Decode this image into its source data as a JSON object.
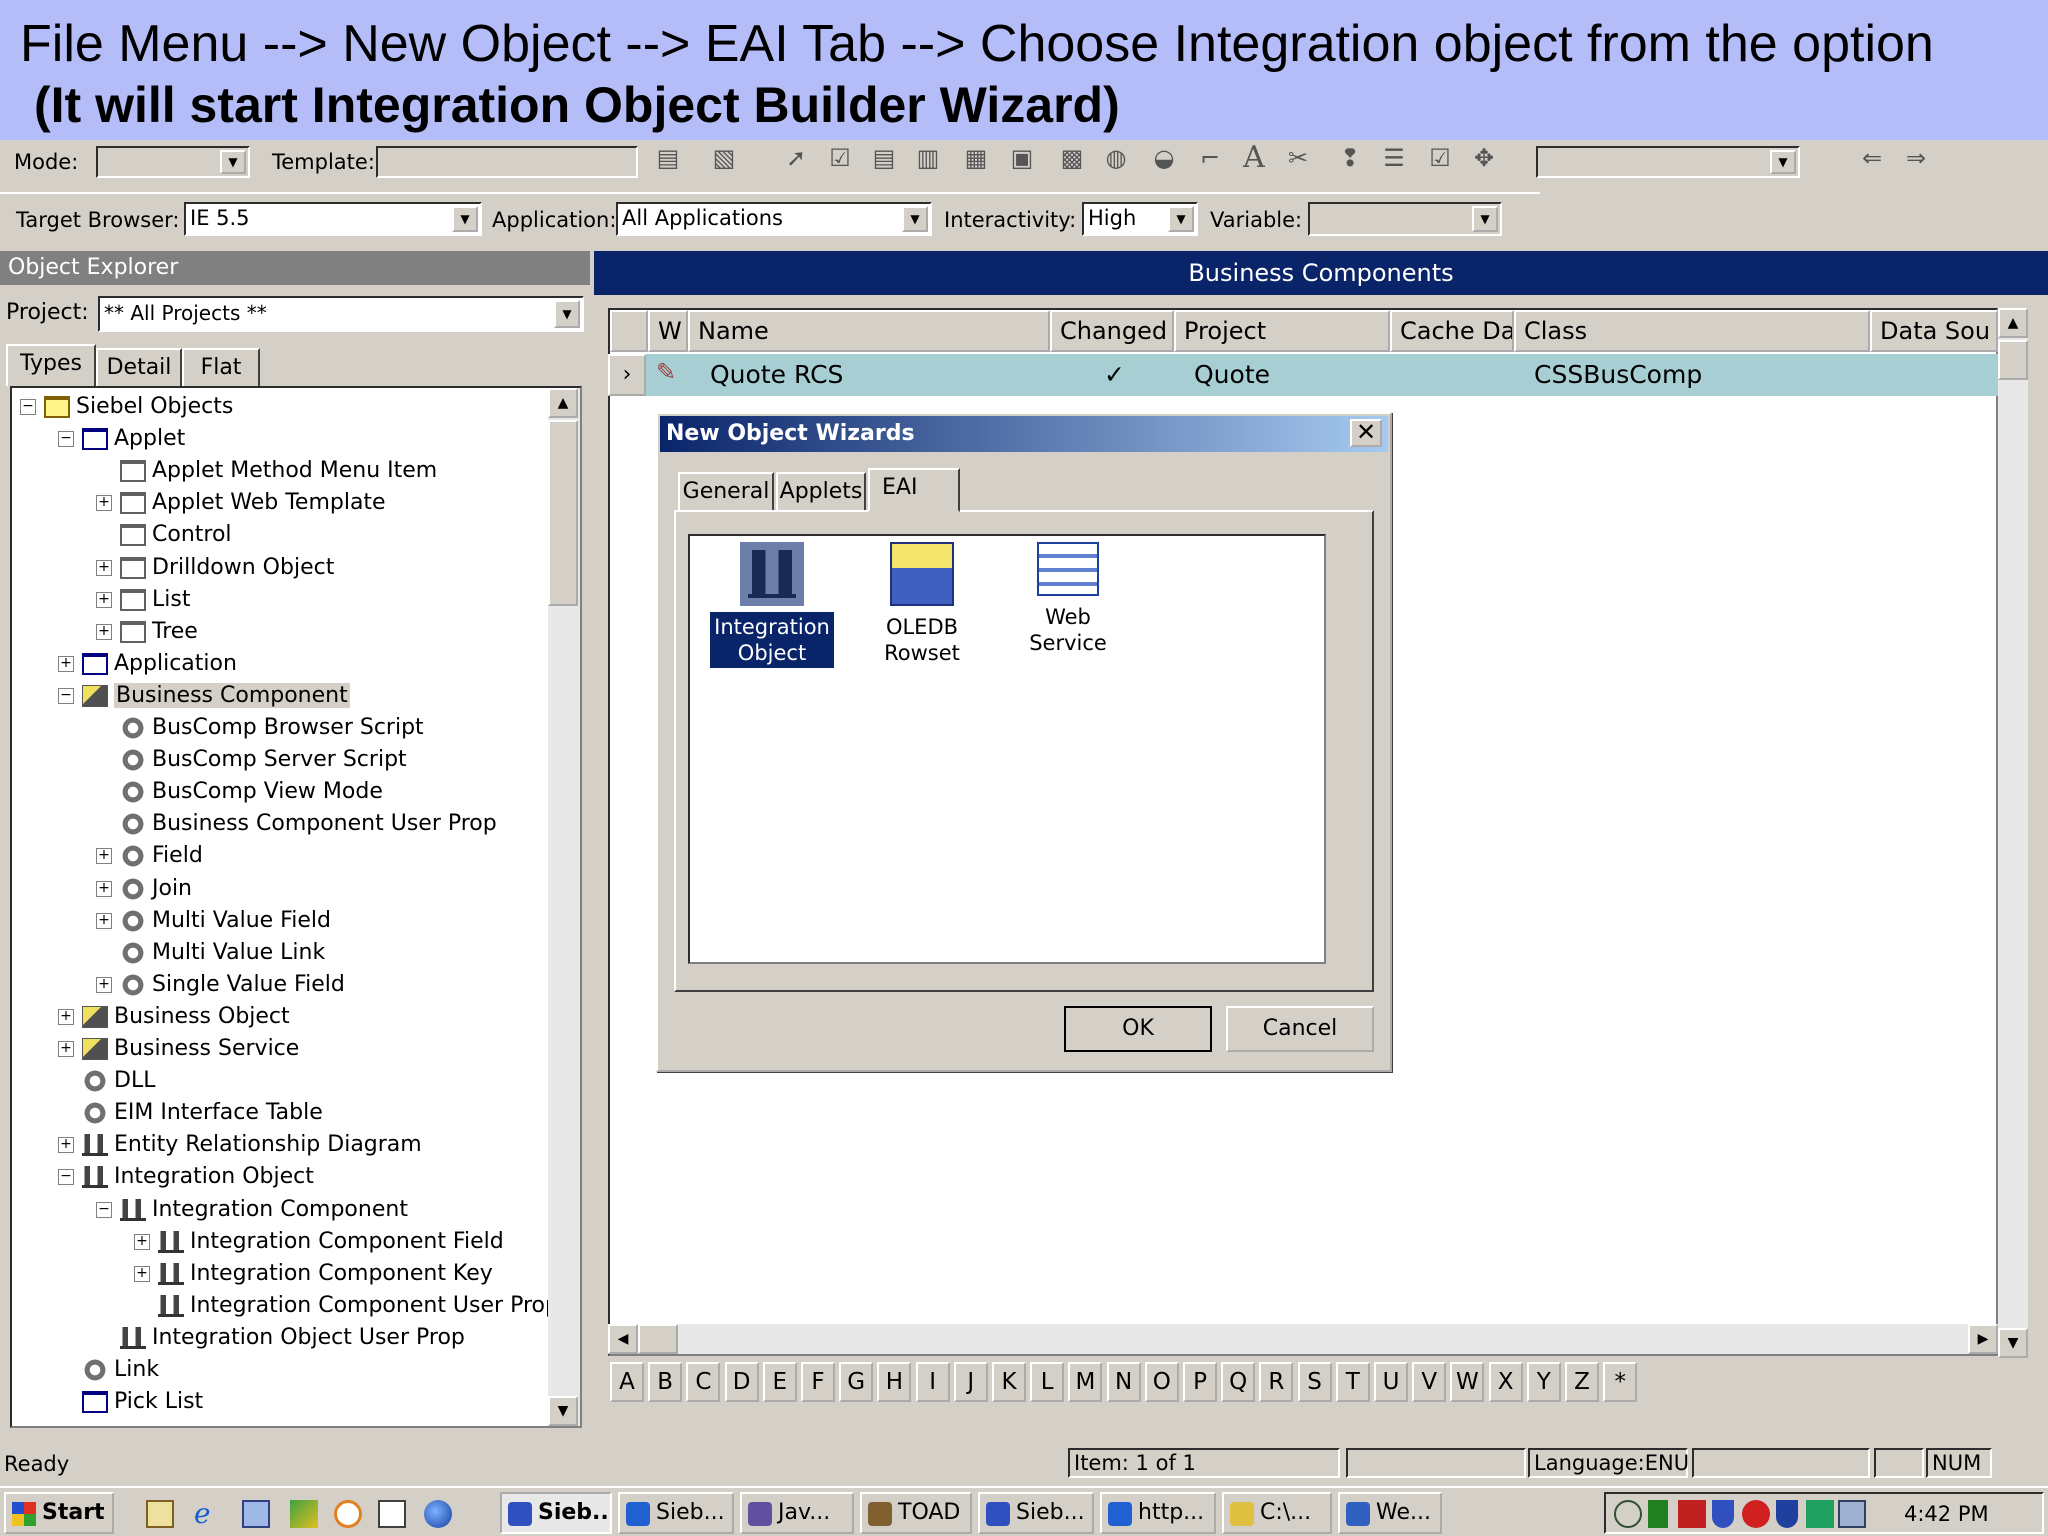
{
  "banner": {
    "line1": "File Menu --> New Object --> EAI Tab --> Choose Integration object from the option",
    "line2": "(It will start Integration Object Builder Wizard)"
  },
  "toolbar1": {
    "mode_label": "Mode:",
    "template_label": "Template:",
    "mode_value": "",
    "template_value": ""
  },
  "toolbar2": {
    "target_browser_label": "Target Browser:",
    "target_browser_value": "IE 5.5",
    "application_label": "Application:",
    "application_value": "All Applications",
    "interactivity_label": "Interactivity:",
    "interactivity_value": "High",
    "variable_label": "Variable:",
    "variable_value": ""
  },
  "object_explorer": {
    "title": "Object Explorer",
    "project_label": "Project:",
    "project_value": "** All Projects **",
    "tabs": [
      "Types",
      "Detail",
      "Flat"
    ],
    "tree": [
      {
        "label": "Siebel Objects",
        "exp": "−",
        "icon": "folder-y"
      },
      {
        "label": "Applet",
        "exp": "−",
        "icon": "folder"
      },
      {
        "label": "Applet Method Menu Item",
        "exp": "",
        "icon": "plain"
      },
      {
        "label": "Applet Web Template",
        "exp": "+",
        "icon": "plain"
      },
      {
        "label": "Control",
        "exp": "",
        "icon": "plain"
      },
      {
        "label": "Drilldown Object",
        "exp": "+",
        "icon": "plain"
      },
      {
        "label": "List",
        "exp": "+",
        "icon": "plain"
      },
      {
        "label": "Tree",
        "exp": "+",
        "icon": "plain"
      },
      {
        "label": "Application",
        "exp": "+",
        "icon": "folder"
      },
      {
        "label": "Business Component",
        "exp": "−",
        "icon": "bc"
      },
      {
        "label": "BusComp Browser Script",
        "exp": "",
        "icon": "gear"
      },
      {
        "label": "BusComp Server Script",
        "exp": "",
        "icon": "gear"
      },
      {
        "label": "BusComp View Mode",
        "exp": "",
        "icon": "gear"
      },
      {
        "label": "Business Component User Prop",
        "exp": "",
        "icon": "gear"
      },
      {
        "label": "Field",
        "exp": "+",
        "icon": "gear"
      },
      {
        "label": "Join",
        "exp": "+",
        "icon": "gear"
      },
      {
        "label": "Multi Value Field",
        "exp": "+",
        "icon": "gear"
      },
      {
        "label": "Multi Value Link",
        "exp": "",
        "icon": "gear"
      },
      {
        "label": "Single Value Field",
        "exp": "+",
        "icon": "gear"
      },
      {
        "label": "Business Object",
        "exp": "+",
        "icon": "bc"
      },
      {
        "label": "Business Service",
        "exp": "+",
        "icon": "bc"
      },
      {
        "label": "DLL",
        "exp": "",
        "icon": "gear"
      },
      {
        "label": "EIM Interface Table",
        "exp": "",
        "icon": "gear"
      },
      {
        "label": "Entity Relationship Diagram",
        "exp": "+",
        "icon": "io"
      },
      {
        "label": "Integration Object",
        "exp": "−",
        "icon": "io"
      },
      {
        "label": "Integration Component",
        "exp": "−",
        "icon": "io"
      },
      {
        "label": "Integration Component Field",
        "exp": "+",
        "icon": "io"
      },
      {
        "label": "Integration Component Key",
        "exp": "+",
        "icon": "io"
      },
      {
        "label": "Integration Component User Prop",
        "exp": "",
        "icon": "io"
      },
      {
        "label": "Integration Object User Prop",
        "exp": "",
        "icon": "io"
      },
      {
        "label": "Link",
        "exp": "",
        "icon": "gear"
      },
      {
        "label": "Pick List",
        "exp": "",
        "icon": "folder"
      }
    ]
  },
  "business_components": {
    "title": "Business Components",
    "columns": [
      "W",
      "Name",
      "Changed",
      "Project",
      "Cache Da",
      "Class",
      "Data Sou"
    ],
    "row": {
      "name": "Quote RCS",
      "changed": "✓",
      "project": "Quote",
      "class": "CSSBusComp"
    },
    "alphabet": [
      "A",
      "B",
      "C",
      "D",
      "E",
      "F",
      "G",
      "H",
      "I",
      "J",
      "K",
      "L",
      "M",
      "N",
      "O",
      "P",
      "Q",
      "R",
      "S",
      "T",
      "U",
      "V",
      "W",
      "X",
      "Y",
      "Z",
      "*"
    ]
  },
  "dialog": {
    "title": "New Object Wizards",
    "close": "✕",
    "tabs": [
      "General",
      "Applets",
      "EAI"
    ],
    "items": [
      "Integration Object",
      "OLEDB Rowset",
      "Web Service"
    ],
    "ok": "OK",
    "cancel": "Cancel"
  },
  "status": {
    "ready": "Ready",
    "item": "Item:  1 of 1",
    "language": "Language:ENU",
    "num": "NUM"
  },
  "taskbar": {
    "start": "Start",
    "tasks": [
      "Sieb...",
      "Sieb...",
      "Jav...",
      "TOAD",
      "Sieb...",
      "http...",
      "C:\\...",
      "We..."
    ],
    "time": "4:42 PM"
  },
  "colors": {
    "banner": "#b4bdf7",
    "title_bar": "#0a246a",
    "selected_row": "#a7cfd3",
    "selection": "#0a246a"
  }
}
